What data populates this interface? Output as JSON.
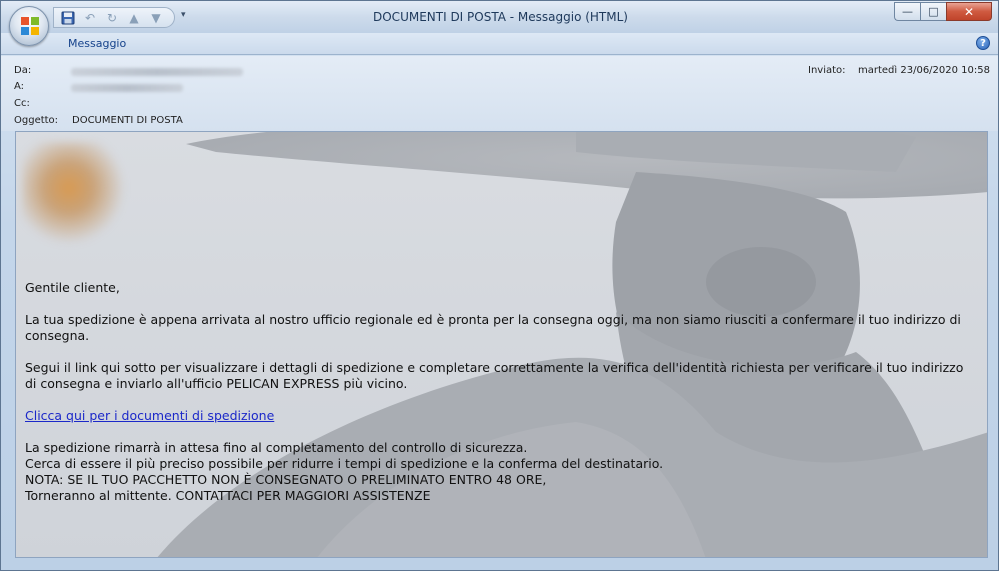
{
  "window": {
    "title": "DOCUMENTI DI POSTA - Messaggio (HTML)",
    "ribbon_tab": "Messaggio",
    "help_glyph": "?",
    "minimize_glyph": "—",
    "maximize_glyph": "□",
    "close_glyph": "✕"
  },
  "quick_access": {
    "save_icon": "save-icon",
    "undo_icon": "undo-icon",
    "redo_icon": "redo-icon",
    "up_icon": "previous-item-icon",
    "down_icon": "next-item-icon",
    "customize_glyph": "▾"
  },
  "header": {
    "from_label": "Da:",
    "to_label": "A:",
    "cc_label": "Cc:",
    "subject_label": "Oggetto:",
    "subject_value": "DOCUMENTI DI POSTA",
    "sent_label": "Inviato:",
    "sent_value": "martedì 23/06/2020 10:58"
  },
  "body": {
    "greeting": "Gentile cliente,",
    "para1": "La tua spedizione è appena arrivata al nostro ufficio regionale ed è pronta per la consegna oggi, ma non siamo riusciti a confermare il tuo indirizzo di consegna.",
    "para2": "Segui il link qui sotto per visualizzare i dettagli di spedizione e completare correttamente la verifica dell'identità richiesta per verificare il tuo indirizzo di consegna e inviarlo all'ufficio PELICAN EXPRESS più vicino.",
    "link": "Clicca qui per i documenti di spedizione",
    "line1": "La spedizione rimarrà in attesa fino al completamento del controllo di sicurezza.",
    "line2": "Cerca di essere il più preciso possibile per ridurre i tempi di spedizione e la conferma del destinatario.",
    "line3": "NOTA: SE IL TUO PACCHETTO NON È CONSEGNATO O PRELIMINATO ENTRO 48 ORE,",
    "line4": "Torneranno al mittente. CONTATTACI PER MAGGIORI ASSISTENZE"
  },
  "colors": {
    "link": "#1b28c9",
    "title_text": "#1e395b",
    "close_button": "#c0442b"
  }
}
